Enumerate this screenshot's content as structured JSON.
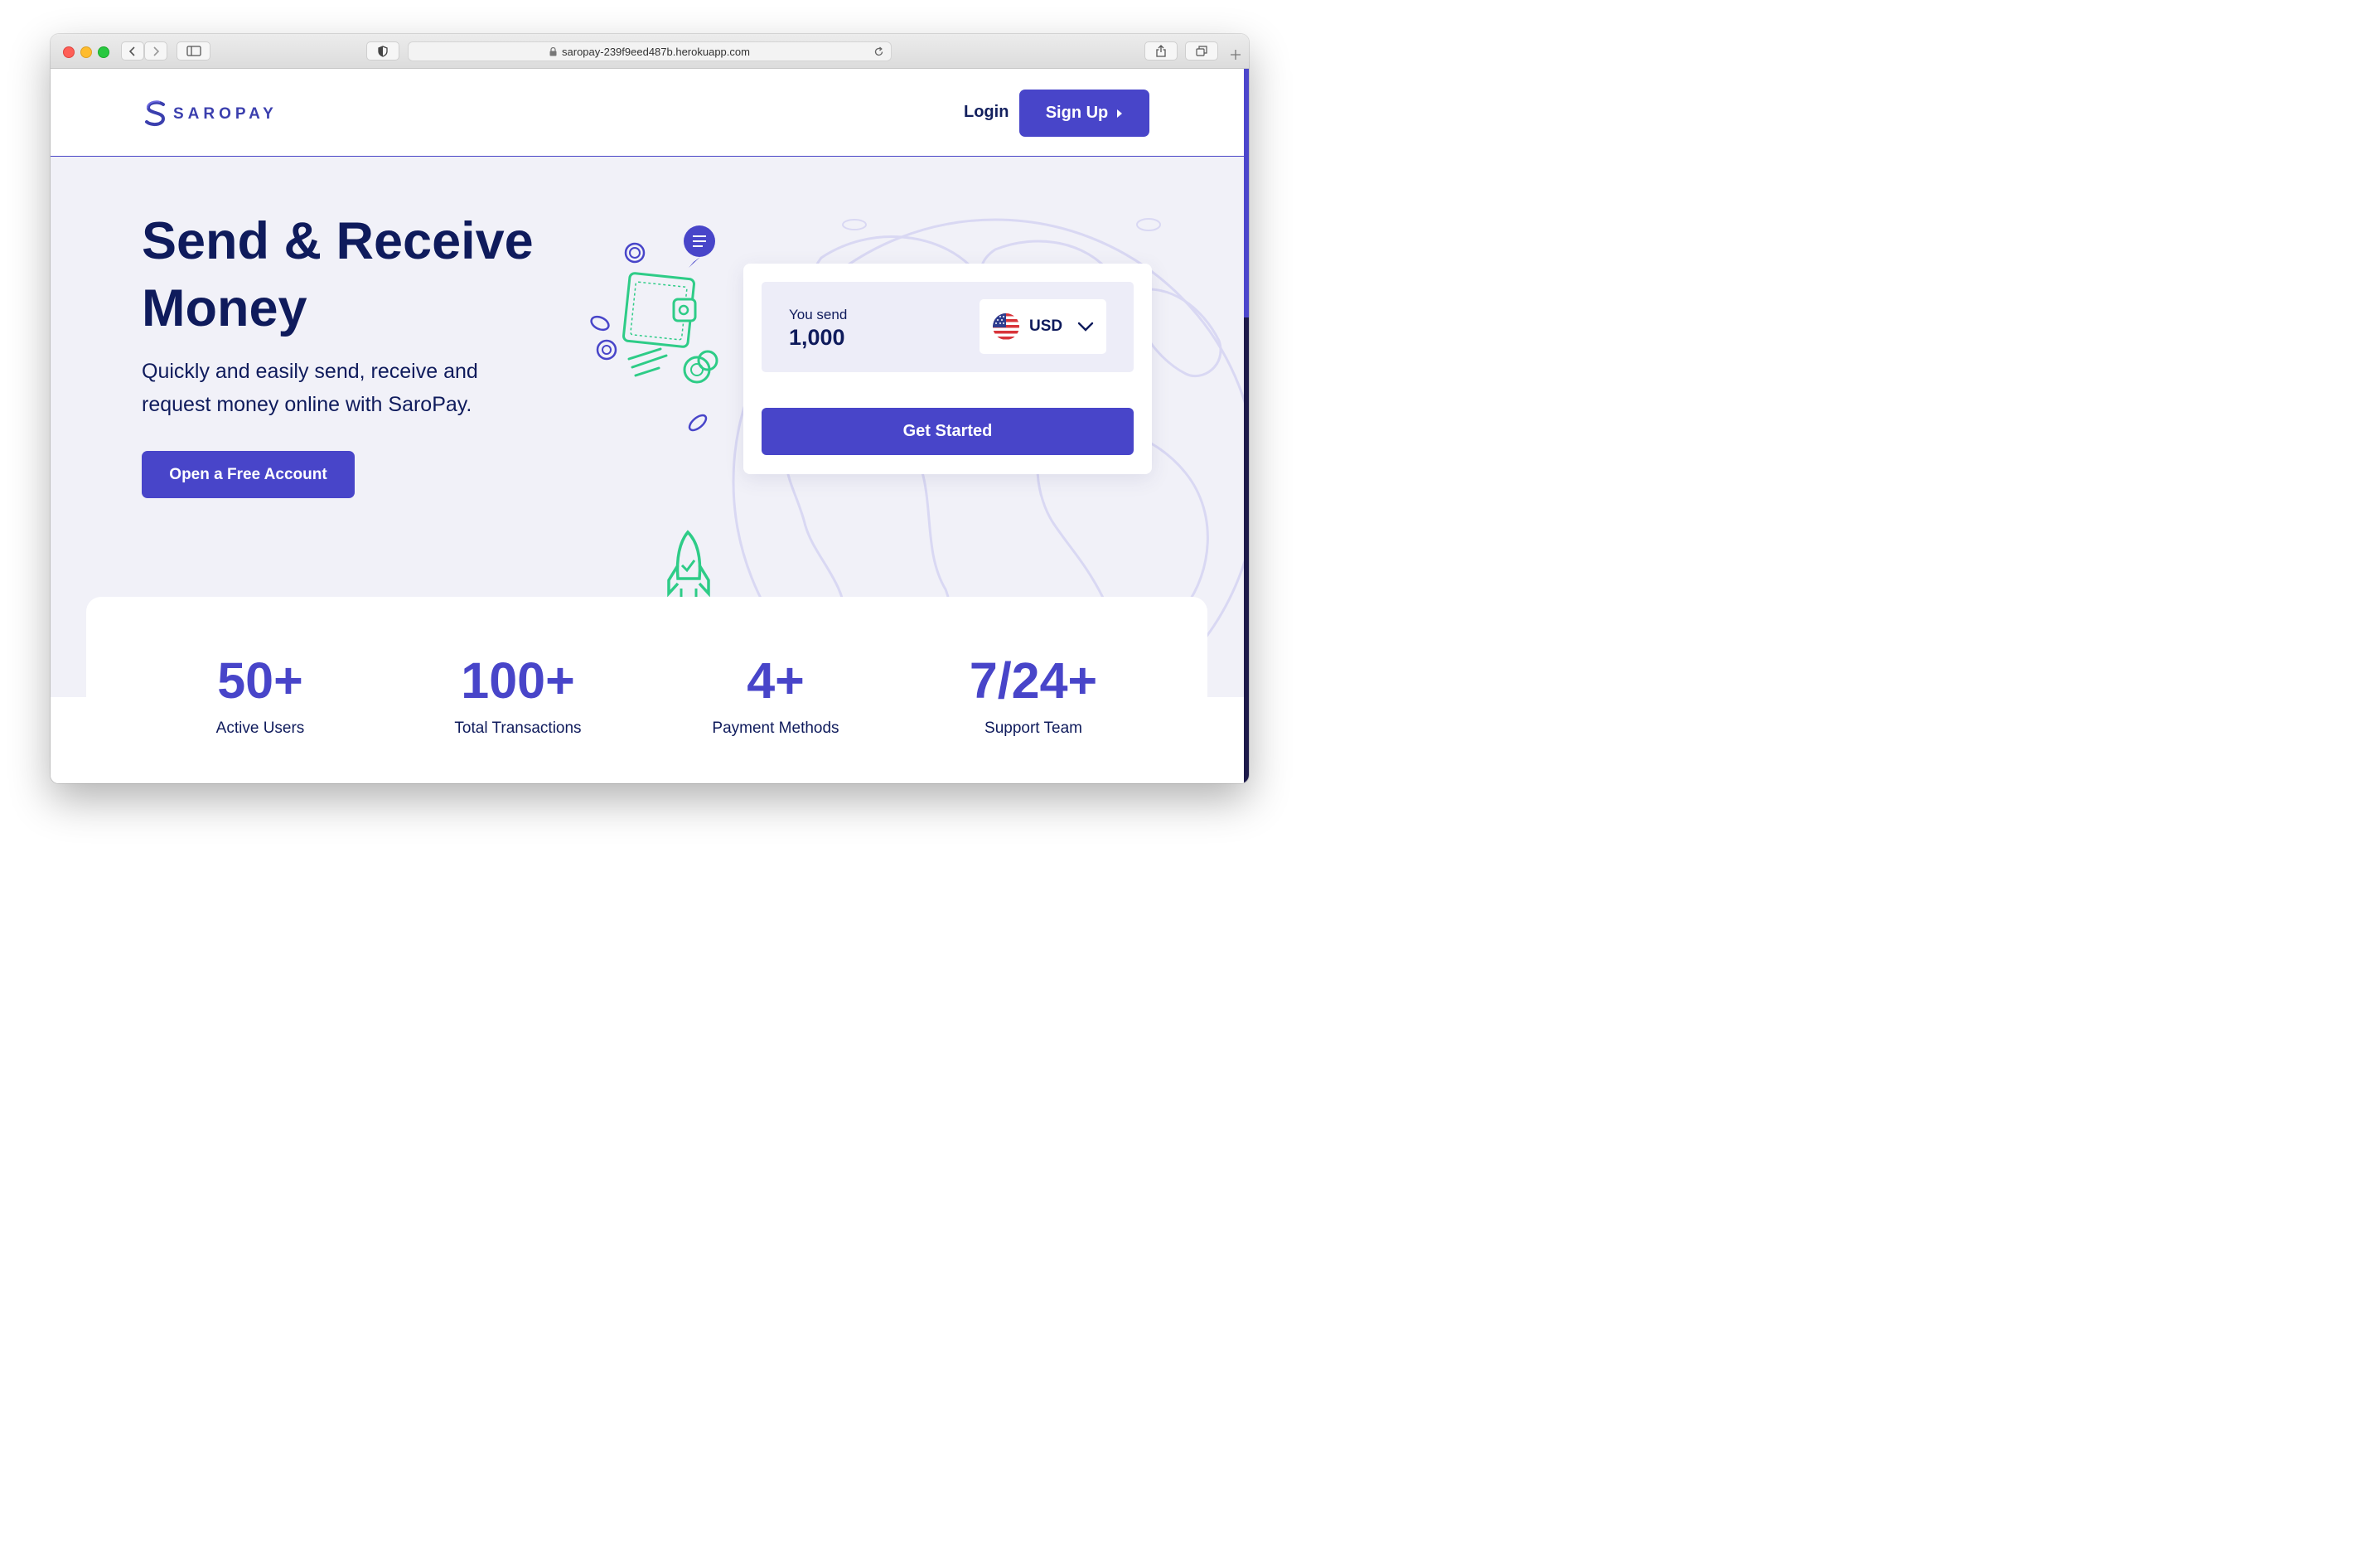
{
  "browser": {
    "url": "saropay-239f9eed487b.herokuapp.com"
  },
  "navbar": {
    "logo_text": "SAROPAY",
    "login_label": "Login",
    "signup_label": "Sign Up"
  },
  "hero": {
    "title": "Send & Receive Money",
    "subtitle": "Quickly and easily send, receive and request money online with SaroPay.",
    "cta_label": "Open a Free Account"
  },
  "send_card": {
    "label": "You send",
    "amount": "1,000",
    "currency": "USD",
    "button_label": "Get Started"
  },
  "stats": [
    {
      "value": "50+",
      "label": "Active Users"
    },
    {
      "value": "100+",
      "label": "Total Transactions"
    },
    {
      "value": "4+",
      "label": "Payment Methods"
    },
    {
      "value": "7/24+",
      "label": "Support Team"
    }
  ],
  "colors": {
    "brand": "#4845c9",
    "navy": "#0f1b5c",
    "accent_green": "#2ecc87",
    "hero_bg": "#f1f1f8"
  },
  "icons": [
    "back-icon",
    "forward-icon",
    "sidebar-icon",
    "shield-icon",
    "lock-icon",
    "reload-icon",
    "share-icon",
    "tabs-icon",
    "new-tab-icon",
    "chevron-down-icon",
    "us-flag-icon"
  ]
}
